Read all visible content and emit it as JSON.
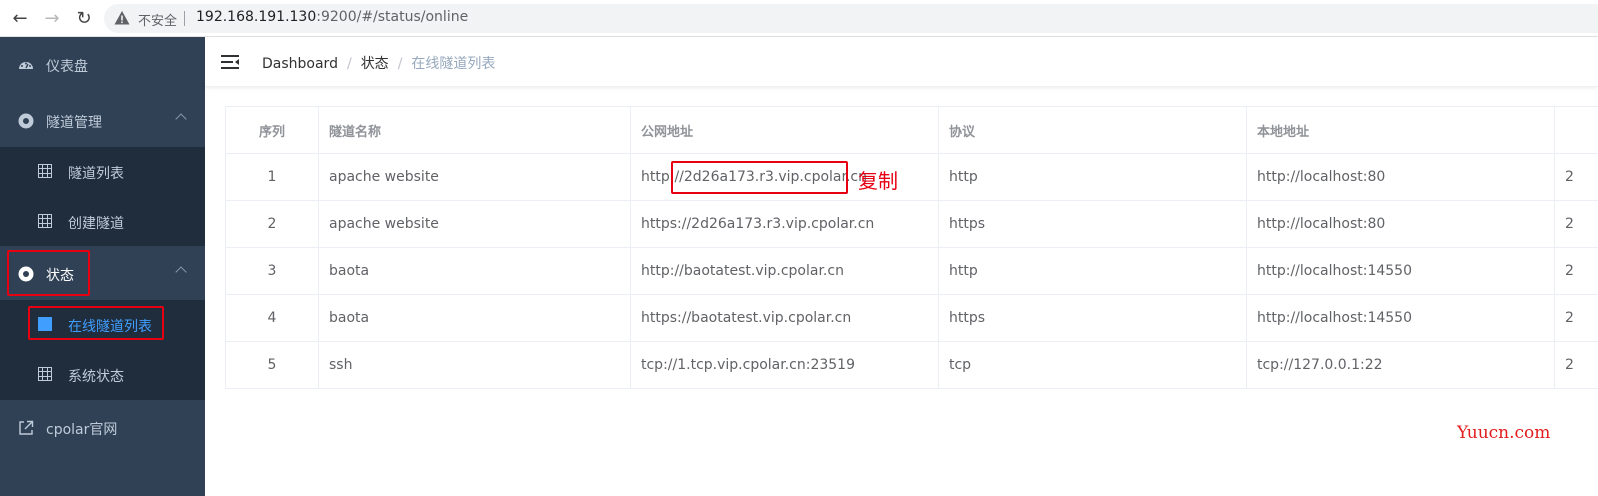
{
  "browser": {
    "back_icon": "arrow-left-icon",
    "forward_icon": "arrow-right-icon",
    "reload_icon": "reload-icon",
    "security_label": "不安全",
    "url_host": "192.168.191.130",
    "url_rest": ":9200/#/status/online"
  },
  "sidebar": {
    "items": [
      {
        "label": "仪表盘",
        "icon": "dashboard-icon"
      },
      {
        "label": "隧道管理",
        "icon": "circle-icon"
      },
      {
        "label": "隧道列表",
        "icon": "grid-icon"
      },
      {
        "label": "创建隧道",
        "icon": "grid-icon"
      },
      {
        "label": "状态",
        "icon": "circle-icon"
      },
      {
        "label": "在线隧道列表",
        "icon": "grid-icon"
      },
      {
        "label": "系统状态",
        "icon": "grid-icon"
      },
      {
        "label": "cpolar官网",
        "icon": "external-link-icon"
      }
    ]
  },
  "header": {
    "breadcrumb": [
      "Dashboard",
      "状态",
      "在线隧道列表"
    ]
  },
  "table": {
    "columns": [
      "序列",
      "隧道名称",
      "公网地址",
      "协议",
      "本地地址",
      ""
    ],
    "rows": [
      [
        "1",
        "apache website",
        "http://2d26a173.r3.vip.cpolar.cn",
        "http",
        "http://localhost:80",
        "2"
      ],
      [
        "2",
        "apache website",
        "https://2d26a173.r3.vip.cpolar.cn",
        "https",
        "http://localhost:80",
        "2"
      ],
      [
        "3",
        "baota",
        "http://baotatest.vip.cpolar.cn",
        "http",
        "http://localhost:14550",
        "2"
      ],
      [
        "4",
        "baota",
        "https://baotatest.vip.cpolar.cn",
        "https",
        "http://localhost:14550",
        "2"
      ],
      [
        "5",
        "ssh",
        "tcp://1.tcp.vip.cpolar.cn:23519",
        "tcp",
        "tcp://127.0.0.1:22",
        "2"
      ]
    ]
  },
  "annotation": {
    "copy_label": "复制"
  },
  "watermark": "Yuucn.com",
  "colors": {
    "sidebar_bg": "#304156",
    "submenu_bg": "#1f2d3d",
    "active": "#409eff",
    "annotation_red": "#e60012"
  }
}
